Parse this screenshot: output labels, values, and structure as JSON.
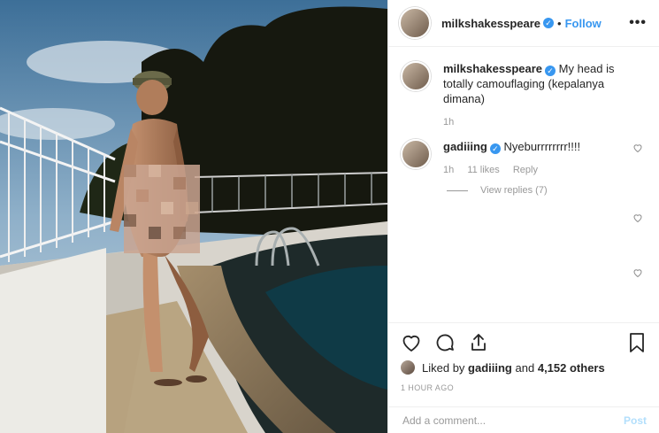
{
  "header": {
    "username": "milkshakesspeare",
    "verified_mark": "✓",
    "separator": "•",
    "follow_label": "Follow",
    "more_label": "•••"
  },
  "caption": {
    "username": "milkshakesspeare",
    "text": "My head is totally camouflaging (kepalanya dimana)",
    "time": "1h"
  },
  "comments": [
    {
      "username": "gadiiing",
      "text": "Nyeburrrrrrrr!!!!",
      "time": "1h",
      "likes": "11 likes",
      "reply_label": "Reply",
      "view_replies": "View replies (7)"
    }
  ],
  "likes": {
    "prefix": "Liked by",
    "user": "gadiiing",
    "and": "and",
    "count": "4,152 others"
  },
  "timestamp": "1 HOUR AGO",
  "add_comment": {
    "placeholder": "Add a comment...",
    "post_label": "Post"
  },
  "icons": {
    "like": "heart-icon",
    "comment": "comment-icon",
    "share": "share-icon",
    "save": "bookmark-icon",
    "comment_like": "small-heart-icon"
  }
}
